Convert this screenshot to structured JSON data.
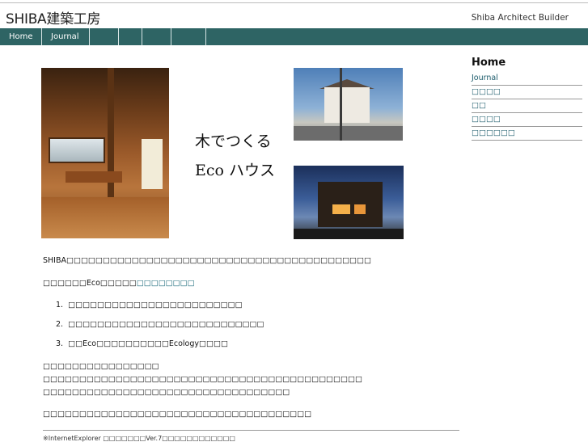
{
  "header": {
    "logo": "SHIBA建築工房",
    "tagline": "Shiba Architect Builder"
  },
  "nav": {
    "items": [
      "Home",
      "Journal",
      "",
      "",
      "",
      ""
    ]
  },
  "hero": {
    "line1": "木でつくる",
    "line2": "Eco ハウス"
  },
  "sidebar": {
    "title": "Home",
    "items": [
      "Journal",
      "□□□□",
      "□□",
      "□□□□",
      "□□□□□□"
    ]
  },
  "content": {
    "intro": "SHIBA□□□□□□□□□□□□□□□□□□□□□□□□□□□□□□□□□□□□□□□□□□",
    "eco_prefix": "□□□□□□Eco□□□□□",
    "eco_link": "□□□□□□□□",
    "list": [
      "□□□□□□□□□□□□□□□□□□□□□□□□",
      "□□□□□□□□□□□□□□□□□□□□□□□□□□□",
      "□□Eco□□□□□□□□□□Ecology□□□□"
    ],
    "para_lines": [
      "□□□□□□□□□□□□□□□□",
      "□□□□□□□□□□□□□□□□□□□□□□□□□□□□□□□□□□□□□□□□□□□□",
      "□□□□□□□□□□□□□□□□□□□□□□□□□□□□□□□□□□"
    ],
    "closing": "□□□□□□□□□□□□□□□□□□□□□□□□□□□□□□□□□□□□□",
    "footnote": "※InternetExplorer □□□□□□□Ver.7□□□□□□□□□□□□"
  },
  "list_numbers": [
    "1.",
    "2.",
    "3."
  ]
}
